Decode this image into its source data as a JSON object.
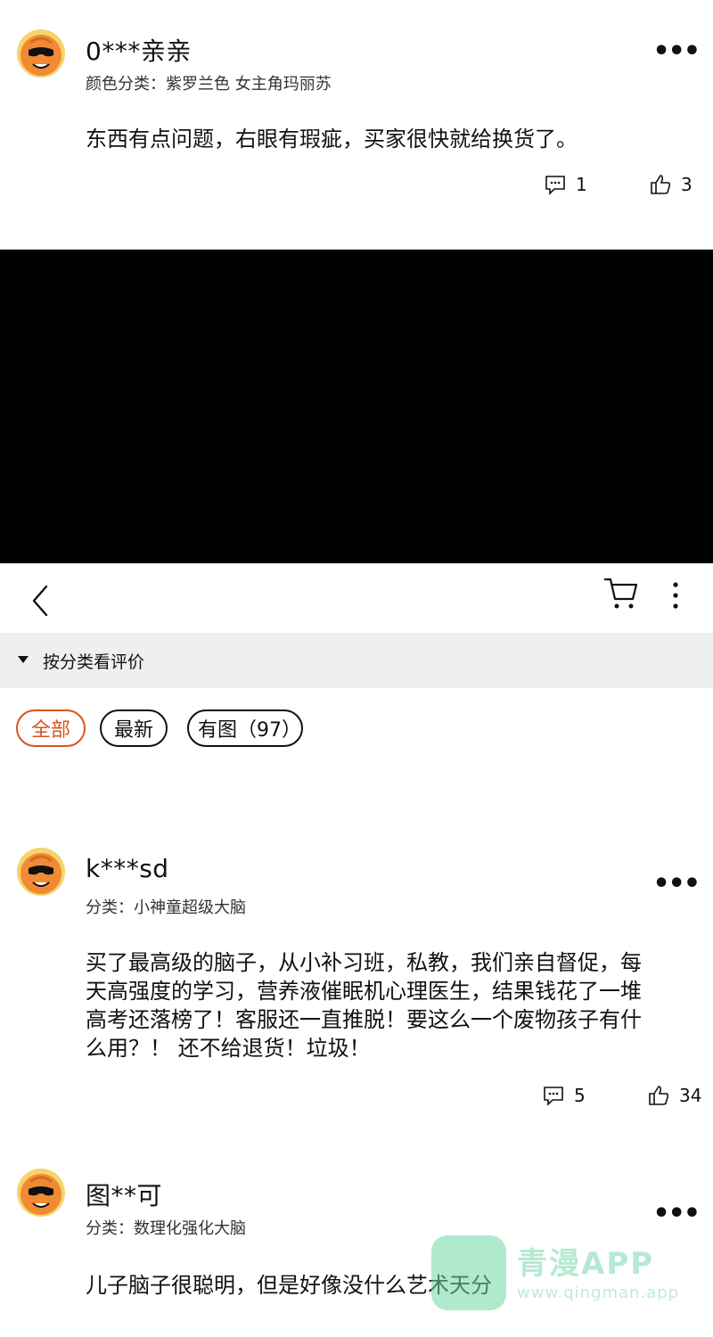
{
  "reviews_top": [
    {
      "username": "0***亲亲",
      "meta": "颜色分类：紫罗兰色  女主角玛丽苏",
      "content": "东西有点问题，右眼有瑕疵，买家很快就给换货了。",
      "comment_count": "1",
      "like_count": "3"
    }
  ],
  "nav": {
    "back_icon": "chevron-left-icon",
    "cart_icon": "cart-icon",
    "more_icon": "kebab-icon"
  },
  "filter": {
    "label": "按分类看评价"
  },
  "chips": [
    {
      "label": "全部",
      "active": true
    },
    {
      "label": "最新",
      "active": false
    },
    {
      "label": "有图（97）",
      "active": false
    }
  ],
  "reviews": [
    {
      "username": "k***sd",
      "meta": "分类：小神童超级大脑",
      "content": "买了最高级的脑子，从小补习班，私教，我们亲自督促，每天高强度的学习，营养液催眠机心理医生，结果钱花了一堆高考还落榜了！客服还一直推脱！要这么一个废物孩子有什么用？！ 还不给退货！垃圾！",
      "comment_count": "5",
      "like_count": "34"
    },
    {
      "username": "图**可",
      "meta": "分类：数理化强化大脑",
      "content": "儿子脑子很聪明，但是好像没什么艺术天分"
    }
  ],
  "more_label": "•••",
  "watermark": {
    "title": "青漫APP",
    "url": "www.qingman.app"
  },
  "colors": {
    "accent": "#d9531e",
    "filter_bg": "#efefef",
    "avatar": "#f08a35"
  }
}
